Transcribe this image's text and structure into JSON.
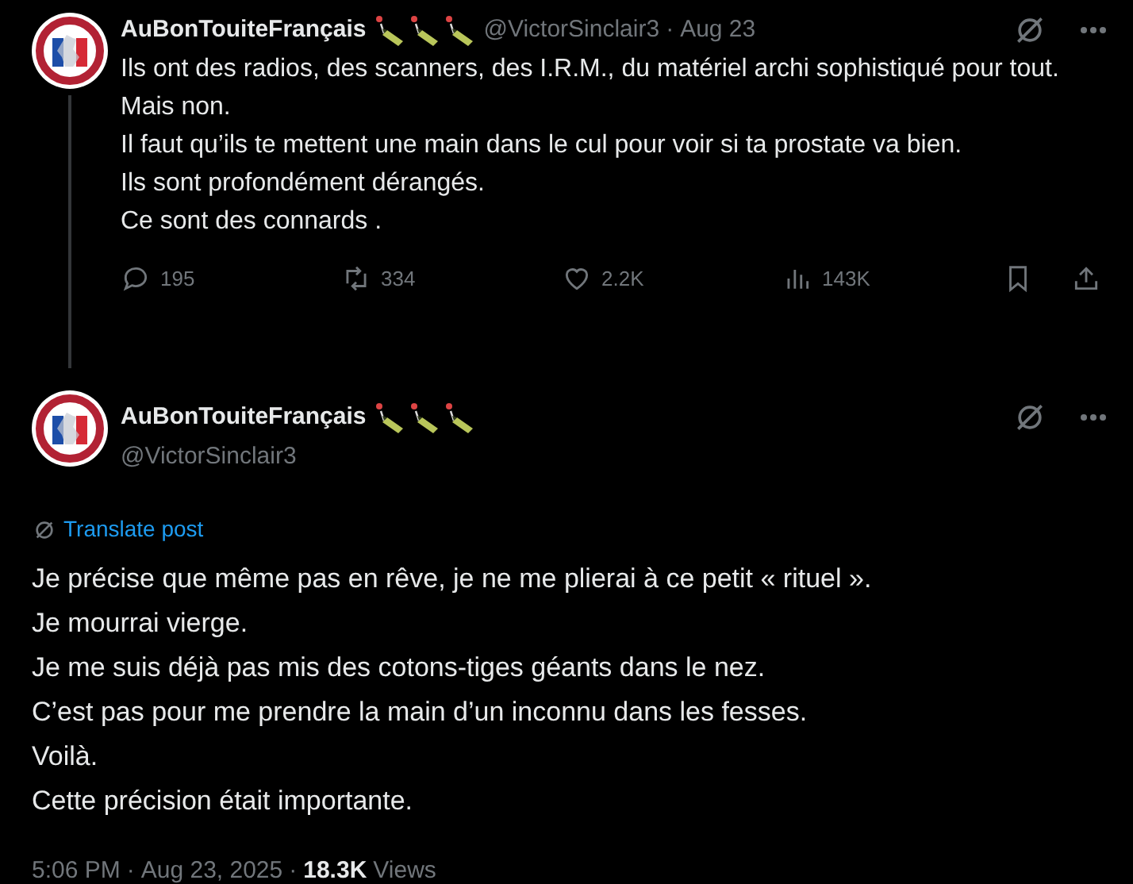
{
  "reply_tweet": {
    "display_name": "AuBonTouiteFrançais",
    "handle": "@VictorSinclair3",
    "separator": "·",
    "date": "Aug 23",
    "lines": [
      "Ils ont des radios, des scanners, des I.R.M., du matériel archi sophistiqué pour tout.",
      "Mais non.",
      "Il faut qu’ils te mettent une main dans le cul pour voir si ta prostate va bien.",
      "Ils sont profondément dérangés.",
      "Ce sont des connards ."
    ],
    "stats": [
      {
        "kind": "reply",
        "count": "195"
      },
      {
        "kind": "repost",
        "count": "334"
      },
      {
        "kind": "like",
        "count": "2.2K"
      },
      {
        "kind": "views",
        "count": "143K"
      }
    ]
  },
  "main_tweet": {
    "display_name": "AuBonTouiteFrançais",
    "handle": "@VictorSinclair3",
    "translate": "Translate post",
    "lines": [
      "Je précise que même pas en rêve, je ne me plierai à ce petit « rituel ».",
      "Je mourrai vierge.",
      "Je me suis déjà pas mis des cotons-tiges géants dans le nez.",
      "C’est pas pour me prendre la main d’un inconnu dans les fesses.",
      "Voilà.",
      "Cette précision était importante."
    ],
    "time": "5:06 PM",
    "date": "Aug 23, 2025",
    "separator_1": "·",
    "separator_2": "·",
    "views_count": "18.3K",
    "views_label": "Views"
  }
}
